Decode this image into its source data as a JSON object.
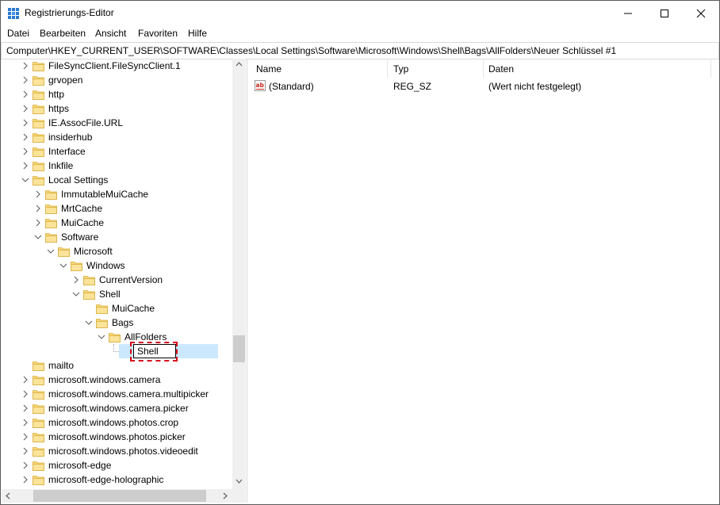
{
  "window": {
    "title": "Registrierungs-Editor",
    "controls": {
      "minimize": "–",
      "maximize": "☐",
      "close": "✕"
    }
  },
  "menubar": {
    "items": [
      "Datei",
      "Bearbeiten",
      "Ansicht",
      "Favoriten",
      "Hilfe"
    ]
  },
  "address": {
    "path": "Computer\\HKEY_CURRENT_USER\\SOFTWARE\\Classes\\Local Settings\\Software\\Microsoft\\Windows\\Shell\\Bags\\AllFolders\\Neuer Schlüssel #1"
  },
  "tree": {
    "items": [
      {
        "label": "FileSyncClient.FileSyncClient.1",
        "level": 0,
        "expand": "collapsed"
      },
      {
        "label": "grvopen",
        "level": 0,
        "expand": "collapsed"
      },
      {
        "label": "http",
        "level": 0,
        "expand": "collapsed"
      },
      {
        "label": "https",
        "level": 0,
        "expand": "collapsed"
      },
      {
        "label": "IE.AssocFile.URL",
        "level": 0,
        "expand": "collapsed"
      },
      {
        "label": "insiderhub",
        "level": 0,
        "expand": "collapsed"
      },
      {
        "label": "Interface",
        "level": 0,
        "expand": "collapsed"
      },
      {
        "label": "Inkfile",
        "level": 0,
        "expand": "collapsed"
      },
      {
        "label": "Local Settings",
        "level": 0,
        "expand": "expanded"
      },
      {
        "label": "ImmutableMuiCache",
        "level": 1,
        "expand": "collapsed"
      },
      {
        "label": "MrtCache",
        "level": 1,
        "expand": "collapsed"
      },
      {
        "label": "MuiCache",
        "level": 1,
        "expand": "collapsed"
      },
      {
        "label": "Software",
        "level": 1,
        "expand": "expanded"
      },
      {
        "label": "Microsoft",
        "level": 2,
        "expand": "expanded"
      },
      {
        "label": "Windows",
        "level": 3,
        "expand": "expanded"
      },
      {
        "label": "CurrentVersion",
        "level": 4,
        "expand": "collapsed"
      },
      {
        "label": "Shell",
        "level": 4,
        "expand": "expanded"
      },
      {
        "label": "MuiCache",
        "level": 5,
        "expand": "none"
      },
      {
        "label": "Bags",
        "level": 5,
        "expand": "expanded"
      },
      {
        "label": "AllFolders",
        "level": 6,
        "expand": "expanded"
      },
      {
        "label": "",
        "level": 7,
        "expand": "none"
      },
      {
        "label": "mailto",
        "level": 0,
        "expand": "none"
      },
      {
        "label": "microsoft.windows.camera",
        "level": 0,
        "expand": "collapsed"
      },
      {
        "label": "microsoft.windows.camera.multipicker",
        "level": 0,
        "expand": "collapsed"
      },
      {
        "label": "microsoft.windows.camera.picker",
        "level": 0,
        "expand": "collapsed"
      },
      {
        "label": "microsoft.windows.photos.crop",
        "level": 0,
        "expand": "collapsed"
      },
      {
        "label": "microsoft.windows.photos.picker",
        "level": 0,
        "expand": "collapsed"
      },
      {
        "label": "microsoft.windows.photos.videoedit",
        "level": 0,
        "expand": "collapsed"
      },
      {
        "label": "microsoft-edge",
        "level": 0,
        "expand": "collapsed"
      },
      {
        "label": "microsoft-edge-holographic",
        "level": 0,
        "expand": "collapsed"
      }
    ],
    "rename_value": "Shell",
    "icons": {
      "folder": "folder-icon",
      "collapsed": "chevron-right-icon",
      "expanded": "chevron-down-icon"
    },
    "colors": {
      "folder": "#f8d775",
      "selection": "#cce8ff",
      "highlight_frame": "#d7001a"
    }
  },
  "list": {
    "headers": [
      "Name",
      "Typ",
      "Daten"
    ],
    "rows": [
      {
        "name": "(Standard)",
        "type": "REG_SZ",
        "data": "(Wert nicht festgelegt)",
        "icon": "reg-sz-icon"
      }
    ]
  }
}
